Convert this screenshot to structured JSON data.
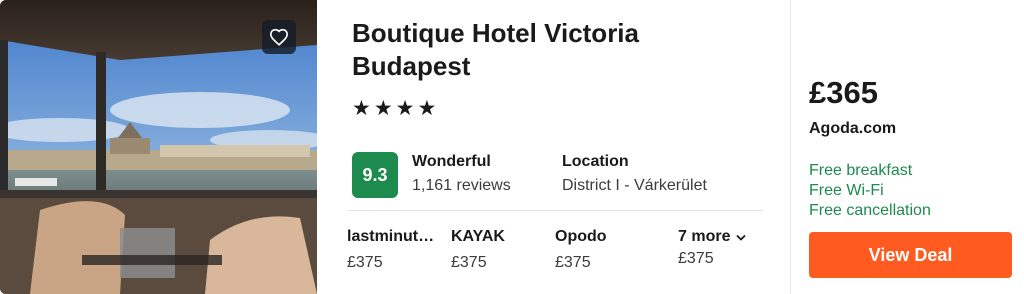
{
  "hotel": {
    "name": "Boutique Hotel Victoria Budapest",
    "stars_text": "★★★★",
    "star_rating": 4
  },
  "rating": {
    "score": "9.3",
    "word": "Wonderful",
    "reviews": "1,161 reviews",
    "badge_color": "#1d8a4e"
  },
  "location": {
    "title": "Location",
    "value": "District I - Várkerület"
  },
  "providers": [
    {
      "name": "lastminute.com",
      "price": "£375"
    },
    {
      "name": "KAYAK",
      "price": "£375"
    },
    {
      "name": "Opodo",
      "price": "£375"
    }
  ],
  "more": {
    "label": "7 more",
    "price": "£375",
    "icon": "chevron-down-icon"
  },
  "deal": {
    "price": "£365",
    "site": "Agoda.com",
    "perks": [
      "Free breakfast",
      "Free Wi-Fi",
      "Free cancellation"
    ],
    "button_label": "View Deal",
    "button_color": "#ff5a1f",
    "perk_color": "#1d8a4e"
  },
  "icons": {
    "favorite": "heart-icon"
  }
}
